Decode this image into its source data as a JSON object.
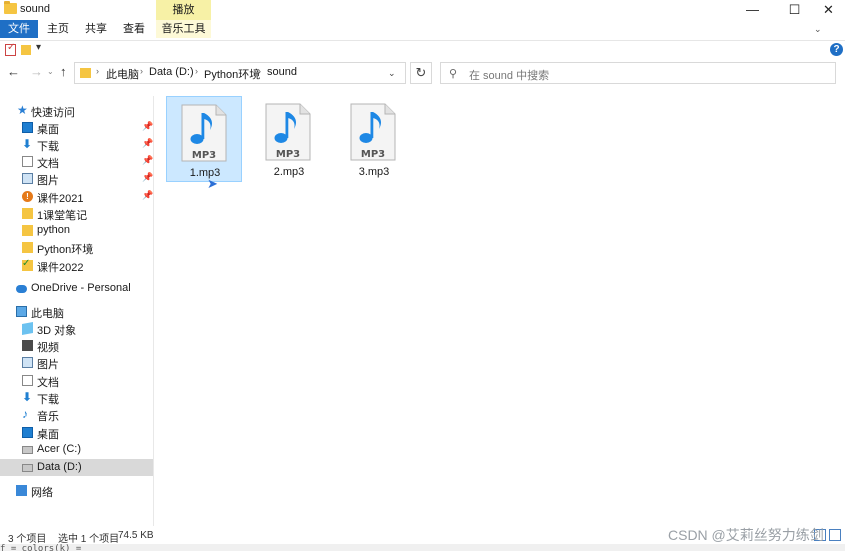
{
  "window": {
    "title": "sound",
    "context_tab": "播放",
    "min": "—",
    "max": "☐",
    "close": "✕"
  },
  "ribbon": {
    "tabs": [
      "文件",
      "主页",
      "共享",
      "查看",
      "音乐工具"
    ],
    "help": "?"
  },
  "address": {
    "crumbs": [
      "此电脑",
      "Data (D:)",
      "Python环境",
      "sound"
    ],
    "search_placeholder": "在 sound 中搜索"
  },
  "sidebar": {
    "quick_access": "快速访问",
    "quick_items": [
      "桌面",
      "下载",
      "文档",
      "图片",
      "课件2021",
      "1课堂笔记",
      "python",
      "Python环境",
      "课件2022"
    ],
    "onedrive": "OneDrive - Personal",
    "this_pc": "此电脑",
    "pc_items": [
      "3D 对象",
      "视频",
      "图片",
      "文档",
      "下载",
      "音乐",
      "桌面",
      "Acer (C:)",
      "Data (D:)"
    ],
    "network": "网络"
  },
  "files": [
    {
      "name": "1.mp3",
      "badge": "MP3"
    },
    {
      "name": "2.mp3",
      "badge": "MP3"
    },
    {
      "name": "3.mp3",
      "badge": "MP3"
    }
  ],
  "status": {
    "count": "3 个项目",
    "selected": "选中 1 个项目",
    "size": "74.5 KB"
  },
  "watermark": "CSDN @艾莉丝努力练剑",
  "codeline": "f = colors(k) ="
}
